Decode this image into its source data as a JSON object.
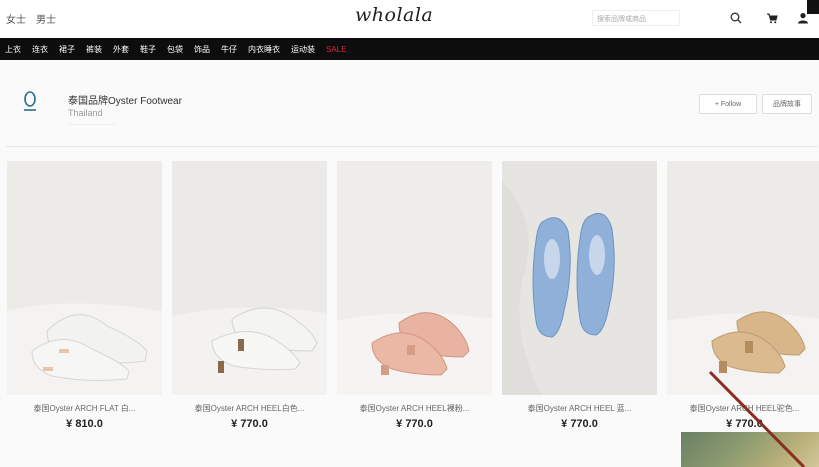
{
  "header": {
    "gender_tabs": [
      "女士",
      "男士"
    ],
    "logo": "wholala",
    "search_placeholder": "搜索品牌或商品"
  },
  "categories": [
    "上衣",
    "连衣",
    "裙子",
    "裤装",
    "外套",
    "鞋子",
    "包袋",
    "饰品",
    "牛仔",
    "内衣睡衣",
    "运动装",
    "SALE"
  ],
  "brand": {
    "name": "泰国品牌Oyster Footwear",
    "country": "Thailand",
    "follow_label": "+ Follow",
    "story_label": "品牌故事"
  },
  "products": [
    {
      "name": "泰国Oyster ARCH FLAT 白...",
      "price": "¥ 810.0",
      "shoe_color": "#f2f2f0",
      "sole_color": "#e6c6a8",
      "bg": "#ecebe8"
    },
    {
      "name": "泰国Oyster ARCH HEEL白色...",
      "price": "¥ 770.0",
      "shoe_color": "#f4f4f3",
      "sole_color": "#8a6a4a",
      "bg": "#ebeae8"
    },
    {
      "name": "泰国Oyster ARCH HEEL裸粉...",
      "price": "¥ 770.0",
      "shoe_color": "#e8b3a0",
      "sole_color": "#d59c86",
      "bg": "#eeedeb"
    },
    {
      "name": "泰国Oyster ARCH HEEL 蓝...",
      "price": "¥ 770.0",
      "shoe_color": "#8fb0d8",
      "sole_color": "#6a8fc0",
      "bg": "#e4e2df"
    },
    {
      "name": "泰国Oyster ARCH HEEL驼色...",
      "price": "¥ 770.0",
      "shoe_color": "#d9b68a",
      "sole_color": "#b58c5e",
      "bg": "#ecebe8"
    }
  ]
}
